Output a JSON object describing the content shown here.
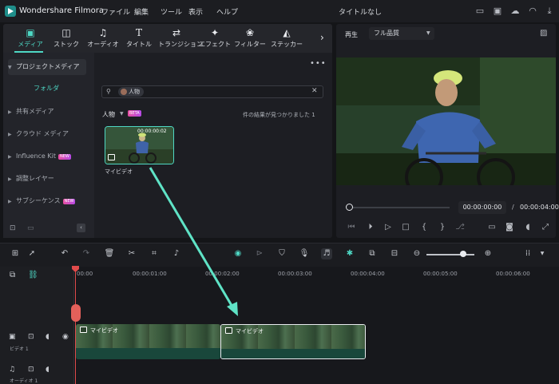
{
  "app": {
    "name": "Wondershare Filmora",
    "project_title": "タイトルなし"
  },
  "menu": [
    "ファイル",
    "編集",
    "ツール",
    "表示",
    "ヘルプ"
  ],
  "title_icons": [
    "layout-icon",
    "save-icon",
    "cloud-upload-icon",
    "headset-icon",
    "download-icon"
  ],
  "tabs": [
    {
      "label": "メディア",
      "icon": "media-icon",
      "active": true
    },
    {
      "label": "ストック",
      "icon": "stock-icon",
      "active": false
    },
    {
      "label": "オーディオ",
      "icon": "music-icon",
      "active": false
    },
    {
      "label": "タイトル",
      "icon": "title-icon",
      "active": false
    },
    {
      "label": "トランジション",
      "icon": "transition-icon",
      "active": false
    },
    {
      "label": "エフェクト",
      "icon": "effect-icon",
      "active": false
    },
    {
      "label": "フィルター",
      "icon": "filter-icon",
      "active": false
    },
    {
      "label": "ステッカー",
      "icon": "sticker-icon",
      "active": false
    }
  ],
  "sidebar": {
    "project_media": "プロジェクトメディア",
    "folder": "フォルダ",
    "items": [
      {
        "label": "共有メディア",
        "badge": ""
      },
      {
        "label": "クラウド メディア",
        "badge": ""
      },
      {
        "label": "Influence Kit",
        "badge": "NEW"
      },
      {
        "label": "調整レイヤー",
        "badge": ""
      },
      {
        "label": "サブシーケンス",
        "badge": "NEW"
      }
    ]
  },
  "media": {
    "search_chip": "人物",
    "filter_label": "人物",
    "beta_badge": "BETA",
    "results_text": "件の結果が見つかりました 1",
    "clip": {
      "name": "マイビデオ",
      "duration": "00:00:00:02"
    }
  },
  "preview": {
    "label": "再生",
    "quality": "フル品質",
    "current_time": "00:00:00:00",
    "separator": "/",
    "total_time": "00:00:04:00"
  },
  "timeline": {
    "ruler": [
      "00:00",
      "00:00:01:00",
      "00:00:02:00",
      "00:00:03:00",
      "00:00:04:00",
      "00:00:05:00",
      "00:00:06:00"
    ],
    "tracks": [
      {
        "name": "ビデオ 1",
        "type": "video"
      },
      {
        "name": "オーディオ 1",
        "type": "audio"
      }
    ],
    "clips": [
      {
        "name": "マイビデオ"
      },
      {
        "name": "マイビデオ"
      }
    ]
  },
  "colors": {
    "accent": "#4ed7c4",
    "playhead": "#e14b4b",
    "background": "#141518"
  }
}
